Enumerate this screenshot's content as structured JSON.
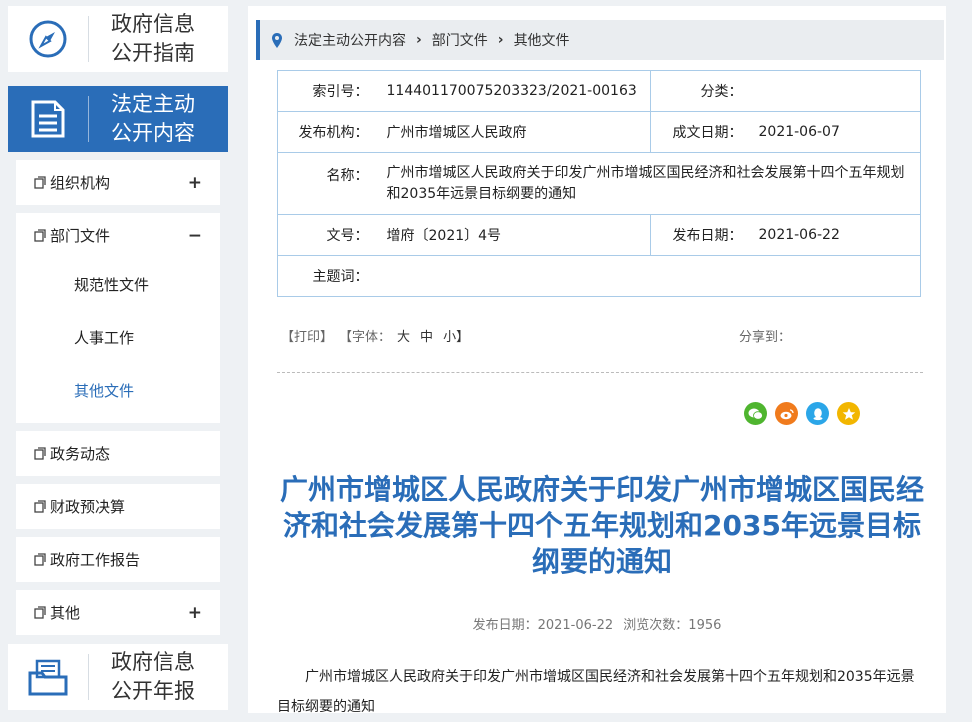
{
  "sidebar": {
    "guide_line1": "政府信息",
    "guide_line2": "公开指南",
    "statutory_line1": "法定主动",
    "statutory_line2": "公开内容",
    "annual_line1": "政府信息",
    "annual_line2": "公开年报",
    "menu": [
      {
        "label": "组织机构",
        "toggle": "+"
      },
      {
        "label": "部门文件",
        "toggle": "−"
      },
      {
        "label": "政务动态"
      },
      {
        "label": "财政预决算"
      },
      {
        "label": "政府工作报告"
      },
      {
        "label": "其他",
        "toggle": "+"
      }
    ],
    "submenu": [
      "规范性文件",
      "人事工作",
      "其他文件"
    ]
  },
  "breadcrumb": [
    "法定主动公开内容",
    "部门文件",
    "其他文件"
  ],
  "info": {
    "index_label": "索引号：",
    "index_value": "11440117007520332 3/2021-00163",
    "category_label": "分类：",
    "category_value": "",
    "publisher_label": "发布机构：",
    "publisher_value": "广州市增城区人民政府",
    "created_label": "成文日期：",
    "created_value": "2021-06-07",
    "name_label": "名称：",
    "name_value": "广州市增城区人民政府关于印发广州市增城区国民经济和社会发展第十四个五年规划和2035年远景目标纲要的通知",
    "docno_label": "文号：",
    "docno_value": "增府〔2021〕4号",
    "pubdate_label": "发布日期：",
    "pubdate_value": "2021-06-22",
    "subject_label": "主题词：",
    "subject_value": ""
  },
  "tools": {
    "print": "【打印】",
    "font_label": "【字体：",
    "size_large": "大",
    "size_medium": "中",
    "size_small": "小】",
    "share_label": "分享到："
  },
  "article": {
    "title": "广州市增城区人民政府关于印发广州市增城区国民经济和社会发展第十四个五年规划和2035年远景目标纲要的通知",
    "meta_pubdate": "发布日期：2021-06-22",
    "meta_views": "浏览次数：1956",
    "body": "广州市增城区人民政府关于印发广州市增城区国民经济和社会发展第十四个五年规划和2035年远景目标纲要的通知"
  },
  "colors": {
    "accent": "#2a6db8",
    "wechat": "#4fb52f",
    "weibo": "#f07b1d",
    "qq": "#2ba6e8",
    "qzone": "#f2b600"
  }
}
